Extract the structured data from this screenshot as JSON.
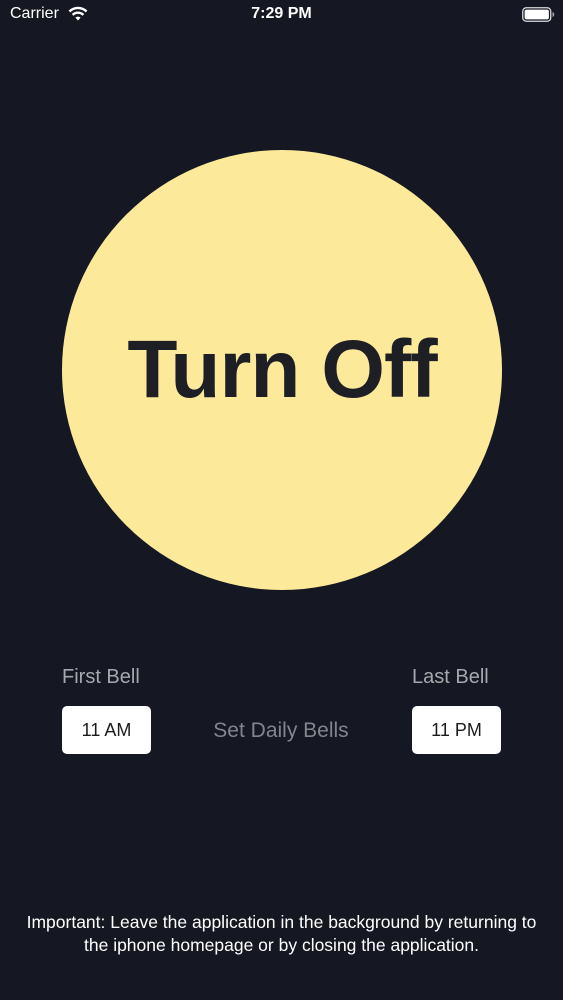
{
  "status_bar": {
    "carrier": "Carrier",
    "time": "7:29 PM",
    "wifi_icon": "wifi-icon",
    "battery_icon": "battery-icon"
  },
  "main_button": {
    "label": "Turn Off",
    "color": "#fde99a"
  },
  "first_bell": {
    "label": "First Bell",
    "value": "11 AM"
  },
  "last_bell": {
    "label": "Last Bell",
    "value": "11 PM"
  },
  "set_daily_bells": {
    "label": "Set Daily Bells"
  },
  "notice": {
    "text": "Important: Leave the application in the background by returning to the iphone homepage or by closing the application."
  },
  "colors": {
    "background": "#151722",
    "accent": "#fde99a"
  }
}
